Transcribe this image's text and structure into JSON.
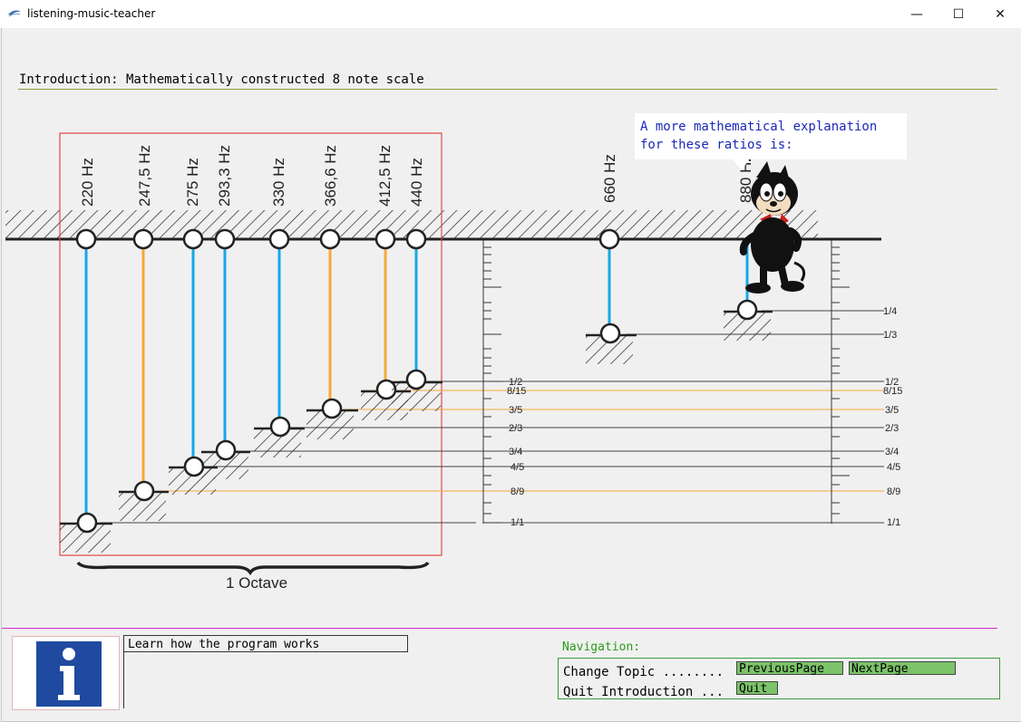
{
  "window": {
    "title": "listening-music-teacher",
    "min": "—",
    "max": "☐",
    "close": "✕"
  },
  "intro": {
    "title": "Introduction: Mathematically constructed 8 note scale"
  },
  "speech": {
    "text": "A more mathematical explanation\nfor these ratios is:"
  },
  "diagram": {
    "notes_in_octave": [
      {
        "hz": "220 Hz",
        "ratio": "1/1",
        "color": "#16a8e8"
      },
      {
        "hz": "247,5 Hz",
        "ratio": "8/9",
        "color": "#f7a93a"
      },
      {
        "hz": "275 Hz",
        "ratio": "4/5",
        "color": "#16a8e8"
      },
      {
        "hz": "293,3 Hz",
        "ratio": "3/4",
        "color": "#16a8e8"
      },
      {
        "hz": "330 Hz",
        "ratio": "2/3",
        "color": "#16a8e8"
      },
      {
        "hz": "366,6 Hz",
        "ratio": "3/5",
        "color": "#f7a93a"
      },
      {
        "hz": "412,5 Hz",
        "ratio": "8/15",
        "color": "#f7a93a"
      },
      {
        "hz": "440 Hz",
        "ratio": "1/2",
        "color": "#16a8e8"
      }
    ],
    "extra_notes": [
      {
        "hz": "660 Hz",
        "ratio": "1/3"
      },
      {
        "hz": "880 Hz",
        "ratio": "1/4"
      }
    ],
    "ratio_labels_left": [
      "1/2",
      "8/15",
      "3/5",
      "2/3",
      "3/4",
      "4/5",
      "8/9",
      "1/1"
    ],
    "ratio_labels_right": [
      "1/4",
      "1/3",
      "1/2",
      "8/15",
      "3/5",
      "2/3",
      "3/4",
      "4/5",
      "8/9",
      "1/1"
    ],
    "octave_label": "1 Octave"
  },
  "learn": {
    "label": "Learn how the program works"
  },
  "navigation": {
    "label": "Navigation:",
    "change_topic": "Change Topic ........",
    "quit_intro": "Quit Introduction ...",
    "previous_page": "PreviousPage",
    "next_page": "NextPage",
    "quit": "Quit"
  },
  "colors": {
    "blue_line": "#16a8e8",
    "orange_line": "#f7a93a",
    "octave_box": "#e04848",
    "info_icon": "#1f4aa0"
  }
}
